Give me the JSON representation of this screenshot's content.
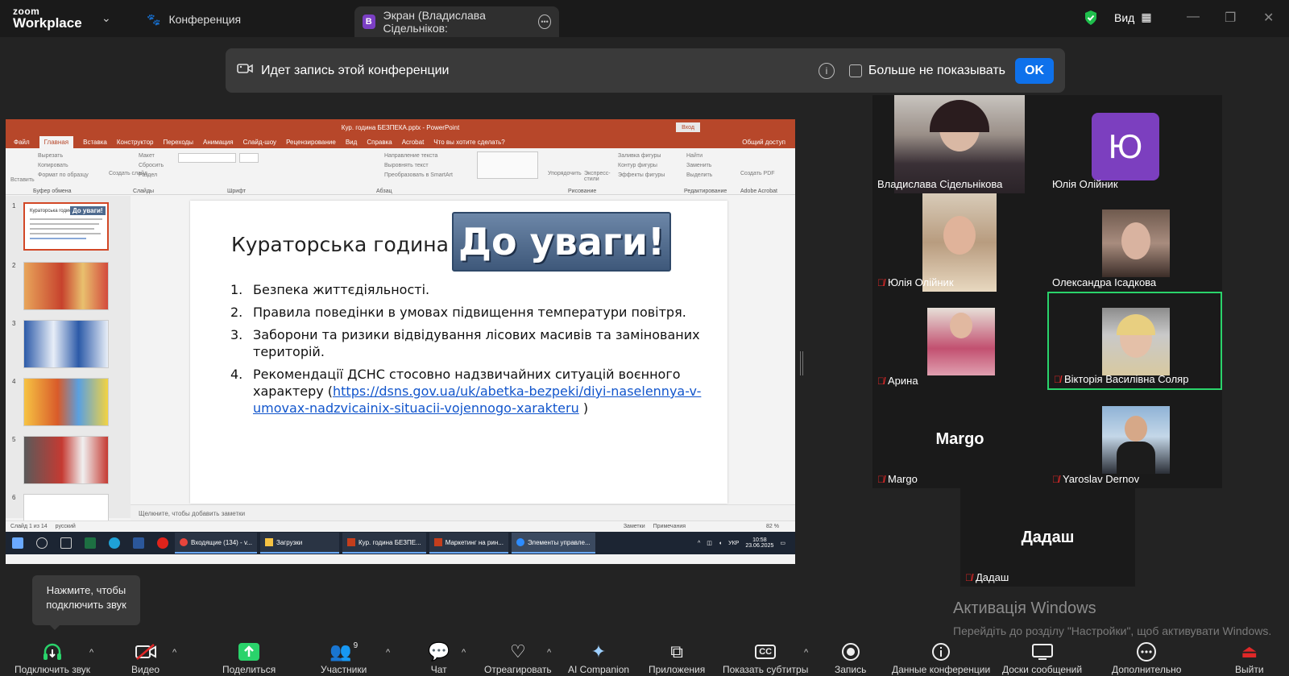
{
  "app": {
    "logo_line1": "zoom",
    "logo_line2": "Workplace"
  },
  "tabs": {
    "conference": "Конференция",
    "screen_badge": "B",
    "screen": "Экран (Владислава Сідельніков:"
  },
  "header": {
    "view": "Вид"
  },
  "banner": {
    "text": "Идет запись этой конференции",
    "dont_show": "Больше не показывать",
    "ok": "OK"
  },
  "ppt": {
    "title": "Кур. година БЕЗПЕКА.pptx - PowerPoint",
    "signin": "Вход",
    "menu": [
      "Файл",
      "Главная",
      "Вставка",
      "Конструктор",
      "Переходы",
      "Анимация",
      "Слайд-шоу",
      "Рецензирование",
      "Вид",
      "Справка",
      "Acrobat",
      "Что вы хотите сделать?"
    ],
    "share": "Общий доступ",
    "ribbon_groups": [
      "Буфер обмена",
      "Слайды",
      "Шрифт",
      "Абзац",
      "Рисование",
      "Редактирование",
      "Adobe Acrobat"
    ],
    "ribbon_items": {
      "paste": "Вставить",
      "cut": "Вырезать",
      "copy": "Копировать",
      "format": "Формат по образцу",
      "create_slide": "Создать слайд",
      "layout": "Макет",
      "reset": "Сбросить",
      "section": "Раздел",
      "text_dir": "Направление текста",
      "align_text": "Выровнять текст",
      "smartart": "Преобразовать в SmartArt",
      "arrange": "Упорядочить",
      "quick_styles": "Экспресс-стили",
      "fill": "Заливка фигуры",
      "outline": "Контур фигуры",
      "effects": "Эффекты фигуры",
      "find": "Найти",
      "replace": "Заменить",
      "select": "Выделить",
      "create_pdf": "Создать PDF"
    },
    "thumb_numbers": [
      "1",
      "2",
      "3",
      "4",
      "5",
      "6"
    ],
    "thumb1_title": "Кураторська година",
    "thumb1_banner": "До уваги!",
    "slide": {
      "title": "Кураторська година",
      "banner": "До уваги!",
      "items": [
        {
          "n": "1.",
          "text": "Безпека життєдіяльності."
        },
        {
          "n": "2.",
          "text": "Правила поведінки в умовах підвищення температури повітря."
        },
        {
          "n": "3.",
          "text": "Заборони та ризики відвідування лісових масивів та замінованих територій."
        },
        {
          "n": "4.",
          "text": "Рекомендації ДСНС стосовно надзвичайних ситуацій воєнного характеру (",
          "link": "https://dsns.gov.ua/uk/abetka-bezpeki/diyi-naselennya-v-umovax-nadzvicainix-situacii-vojennogo-xarakteru",
          "after": " )"
        }
      ]
    },
    "notes_placeholder": "Щелкните, чтобы добавить заметки",
    "status": {
      "slide": "Слайд 1 из 14",
      "lang": "русский",
      "notes": "Заметки",
      "comments": "Примечания",
      "zoom": "82 %"
    }
  },
  "taskbar": {
    "apps": [
      "Входящие (134) - v...",
      "Загрузки",
      "Кур. година БЕЗПЕ...",
      "Маркетинг на рин...",
      "Элементы управле..."
    ],
    "lang": "УКР",
    "time": "10:58",
    "date": "23.06.2025"
  },
  "participants": [
    {
      "name": "Владислава Сідельнікова",
      "muted": false
    },
    {
      "name": "Юлія Олійник",
      "muted": false,
      "avatar": "Ю"
    },
    {
      "name": "Юлія Олійник",
      "muted": true
    },
    {
      "name": "Олександра Ісадкова",
      "muted": false
    },
    {
      "name": "Арина",
      "muted": true
    },
    {
      "name": "Вікторія Василівна Соляр",
      "muted": true,
      "active": true
    },
    {
      "name": "Margo",
      "muted": true,
      "big": "Margo"
    },
    {
      "name": "Yaroslav Dernov",
      "muted": true
    },
    {
      "name": "Дадаш",
      "muted": true,
      "big": "Дадаш"
    }
  ],
  "more_label": "···",
  "tooltip": "Нажмите, чтобы подключить звук",
  "activation": {
    "title": "Активація Windows",
    "text": "Перейдіть до розділу \"Настройки\", щоб активувати Windows."
  },
  "toolbar": {
    "audio": "Подключить звук",
    "video": "Видео",
    "share": "Поделиться",
    "participants": "Участники",
    "participants_count": "9",
    "chat": "Чат",
    "react": "Отреагировать",
    "ai": "AI Companion",
    "apps": "Приложения",
    "captions": "Показать субтитры",
    "record": "Запись",
    "info": "Данные конференции",
    "whiteboards": "Доски сообщений",
    "more": "Дополнительно",
    "leave": "Выйти"
  },
  "colors": {
    "accent": "#0e71eb",
    "active_speaker": "#2ad36b",
    "ppt": "#b7472a",
    "muted": "#e02828",
    "avatar": "#7c3fbf"
  }
}
